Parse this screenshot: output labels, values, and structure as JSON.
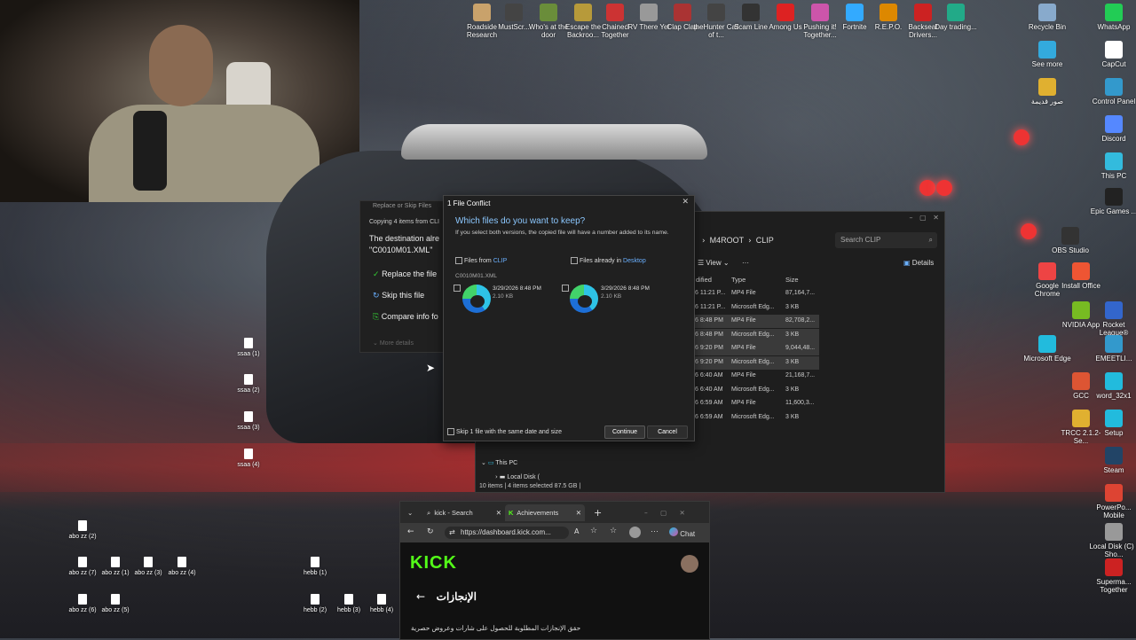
{
  "desktop": {
    "top_icons": [
      {
        "label": "Roadside Research",
        "color": "#c9a26b"
      },
      {
        "label": "MustScr...",
        "color": "#444"
      },
      {
        "label": "Who's at the door",
        "color": "#6a8d3a"
      },
      {
        "label": "Escape the Backroo...",
        "color": "#b79a3a"
      },
      {
        "label": "Chained Together",
        "color": "#c33"
      },
      {
        "label": "RV There Yet",
        "color": "#999"
      },
      {
        "label": "Clap Clap",
        "color": "#a33"
      },
      {
        "label": "theHunter Call of t...",
        "color": "#444"
      },
      {
        "label": "Scam Line",
        "color": "#333"
      },
      {
        "label": "Among Us",
        "color": "#d22"
      },
      {
        "label": "Pushing it! Together...",
        "color": "#c5a"
      },
      {
        "label": "Fortnite",
        "color": "#3af"
      },
      {
        "label": "R.E.P.O.",
        "color": "#d80"
      },
      {
        "label": "Backseat Drivers...",
        "color": "#c22"
      },
      {
        "label": "Day trading...",
        "color": "#2a8"
      }
    ],
    "right_icons": [
      {
        "label": "Recycle Bin",
        "color": "#8ac"
      },
      {
        "label": "WhatsApp",
        "color": "#2c5"
      },
      {
        "label": "See more",
        "color": "#3ad"
      },
      {
        "label": "CapCut",
        "color": "#fff"
      },
      {
        "label": "صور قديمة",
        "color": "#e0b030"
      },
      {
        "label": "Control Panel",
        "color": "#39c"
      },
      {
        "label": "Discord",
        "color": "#58f"
      },
      {
        "label": "This PC",
        "color": "#3bd"
      },
      {
        "label": "Epic Games ...",
        "color": "#222"
      },
      {
        "label": "OBS Studio",
        "color": "#333"
      },
      {
        "label": "Google Chrome",
        "color": "#e44"
      },
      {
        "label": "Install Office",
        "color": "#e53"
      },
      {
        "label": "NVIDIA App",
        "color": "#7b2"
      },
      {
        "label": "Rocket League®",
        "color": "#36c"
      },
      {
        "label": "Microsoft Edge",
        "color": "#2bd"
      },
      {
        "label": "EMEETLI...",
        "color": "#39c"
      },
      {
        "label": "GCC",
        "color": "#d53"
      },
      {
        "label": "word_32x1",
        "color": "#2bd"
      },
      {
        "label": "TRCC 2.1.2-Se...",
        "color": "#e0b030"
      },
      {
        "label": "Setup",
        "color": "#2bd"
      },
      {
        "label": "Steam",
        "color": "#246"
      },
      {
        "label": "PowerPo... Mobile",
        "color": "#d43"
      },
      {
        "label": "Local Disk (C) - Sho...",
        "color": "#999"
      },
      {
        "label": "Superma... Together",
        "color": "#c22"
      }
    ],
    "left_files": [
      "ssaa (1)",
      "ssaa (2)",
      "ssaa (3)",
      "ssaa (4)"
    ],
    "bottom_files": [
      "abo zz (2)",
      "abo zz (7)",
      "abo zz (1)",
      "abo zz (3)",
      "abo zz (4)",
      "hebb (1)",
      "abo zz (6)",
      "abo zz (5)",
      "hebb (2)",
      "hebb (3)",
      "hebb (4)"
    ]
  },
  "copy_progress": {
    "title": "Replace or Skip Files",
    "copying": "Copying 4 items from CLI",
    "dest_line1": "The destination alre",
    "dest_line2": "\"C0010M01.XML\"",
    "opt_replace": "Replace the file",
    "opt_skip": "Skip this file",
    "opt_compare": "Compare info fo",
    "more": "More details"
  },
  "conflict_dialog": {
    "title": "1 File Conflict",
    "question": "Which files do you want to keep?",
    "description": "If you select both versions, the copied file will have a number added to its name.",
    "from_prefix": "Files from",
    "from_folder": "CLIP",
    "already_prefix": "Files already in",
    "already_folder": "Desktop",
    "filename": "C0010M01.XML",
    "left_date": "3/29/2026 8:48 PM",
    "left_size": "2.10 KB",
    "right_date": "3/29/2026 8:48 PM",
    "right_size": "2.10 KB",
    "skip_label": "Skip 1 file with the same date and size",
    "continue": "Continue",
    "cancel": "Cancel",
    "close": "✕"
  },
  "explorer": {
    "path": [
      "M4ROOT",
      "CLIP"
    ],
    "search_placeholder": "Search CLIP",
    "view_label": "View",
    "more_label": "···",
    "details_label": "Details",
    "columns": {
      "modified": "dified",
      "type": "Type",
      "size": "Size"
    },
    "rows": [
      {
        "modified": "6 11:21 P...",
        "type": "MP4 File",
        "size": "87,164,7...",
        "selected": false
      },
      {
        "modified": "6 11:21 P...",
        "type": "Microsoft Edg...",
        "size": "3 KB",
        "selected": false
      },
      {
        "modified": "6 8:48 PM",
        "type": "MP4 File",
        "size": "82,708,2...",
        "selected": true
      },
      {
        "modified": "6 8:48 PM",
        "type": "Microsoft Edg...",
        "size": "3 KB",
        "selected": true
      },
      {
        "modified": "6 9:20 PM",
        "type": "MP4 File",
        "size": "9,044,48...",
        "selected": true
      },
      {
        "modified": "6 9:20 PM",
        "type": "Microsoft Edg...",
        "size": "3 KB",
        "selected": true
      },
      {
        "modified": "6 6:40 AM",
        "type": "MP4 File",
        "size": "21,168,7...",
        "selected": false
      },
      {
        "modified": "6 6:40 AM",
        "type": "Microsoft Edg...",
        "size": "3 KB",
        "selected": false
      },
      {
        "modified": "6 6:59 AM",
        "type": "MP4 File",
        "size": "11,600,3...",
        "selected": false
      },
      {
        "modified": "6 6:59 AM",
        "type": "Microsoft Edg...",
        "size": "3 KB",
        "selected": false
      }
    ],
    "tree_this_pc": "This PC",
    "tree_local_disk": "Local Disk (",
    "status": "10 items  |  4 items selected  87.5 GB  |"
  },
  "browser": {
    "tab1": "kick - Search",
    "tab2": "Achievements",
    "url": "https://dashboard.kick.com...",
    "chat": "Chat",
    "logo": "KICK",
    "heading": "الإنجازات",
    "desc": "حقق الإنجازات المطلوبة للحصول على شارات وعروض حصرية"
  }
}
